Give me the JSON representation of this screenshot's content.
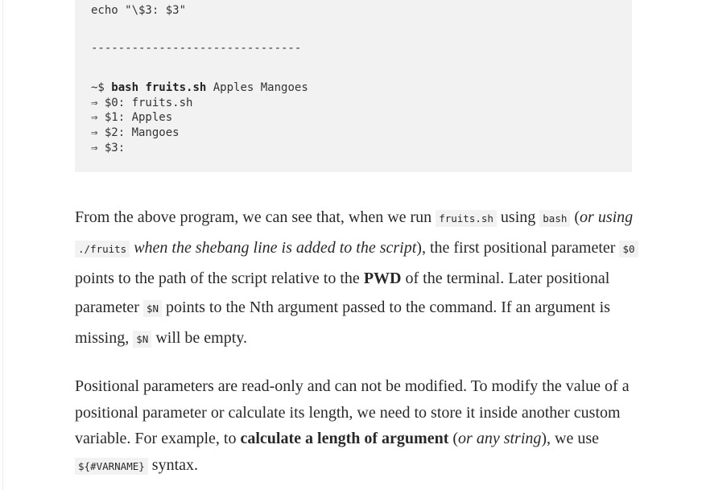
{
  "code": {
    "lines": [
      {
        "prefix": "echo \"\\$3: $3\"",
        "bold": "",
        "suffix": ""
      },
      {
        "prefix": "",
        "bold": "",
        "suffix": ""
      },
      {
        "prefix": "-------------------------------",
        "bold": "",
        "suffix": ""
      },
      {
        "prefix": "",
        "bold": "",
        "suffix": ""
      },
      {
        "prefix": "~$ ",
        "bold": "bash fruits.sh",
        "suffix": " Apples Mangoes"
      },
      {
        "prefix": "⇒ $0: fruits.sh",
        "bold": "",
        "suffix": ""
      },
      {
        "prefix": "⇒ $1: Apples",
        "bold": "",
        "suffix": ""
      },
      {
        "prefix": "⇒ $2: Mangoes",
        "bold": "",
        "suffix": ""
      },
      {
        "prefix": "⇒ $3:",
        "bold": "",
        "suffix": ""
      }
    ]
  },
  "para1": {
    "t1": "From the above program, we can see that, when we run ",
    "c1": "fruits.sh",
    "t2": " using ",
    "c2": "bash",
    "t3": " (",
    "e1": "or using ",
    "c3": "./fruits",
    "e2": " when the shebang line is added to the script",
    "t4": "), the first positional parameter ",
    "c4": "$0",
    "t5": " points to the path of the script relative to the ",
    "b1": "PWD",
    "t6": " of the terminal. Later positional parameter ",
    "c5": "$N",
    "t7": " points to the Nth argument passed to the command. If an argument is missing, ",
    "c6": "$N",
    "t8": " will be empty."
  },
  "para2": {
    "t1": "Positional parameters are read-only and can not be modified. To modify the value of a positional parameter or calculate its length, we need to store it inside another custom variable. For example, to ",
    "b1": "calculate a length of argument",
    "t2": " (",
    "e1": "or any string",
    "t3": "), we use ",
    "c1": "${#VARNAME}",
    "t4": " syntax."
  }
}
